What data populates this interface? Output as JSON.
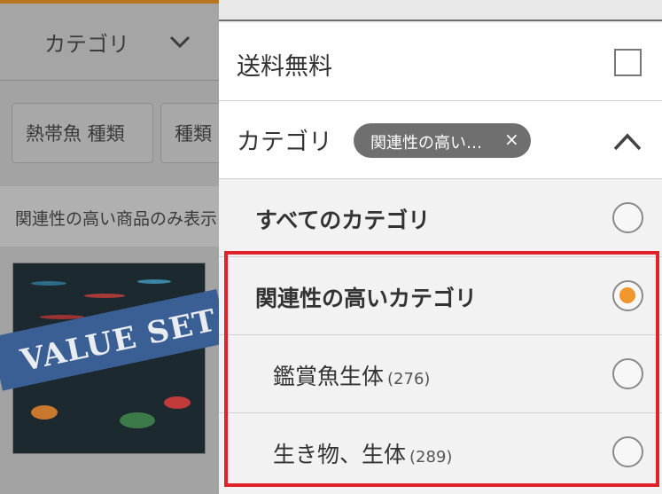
{
  "background": {
    "category_label": "カテゴリ",
    "chips": [
      "熱帯魚 種類",
      "種類"
    ],
    "notice": "関連性の高い商品のみ表示",
    "product_banner": "VALUE SET"
  },
  "drawer": {
    "shipping": {
      "label": "送料無料",
      "checked": false
    },
    "category": {
      "label": "カテゴリ",
      "chip_text": "関連性の高い…",
      "chip_close": "×",
      "expanded": true
    },
    "options": [
      {
        "label": "すべてのカテゴリ",
        "count": "",
        "selected": false
      },
      {
        "label": "関連性の高いカテゴリ",
        "count": "",
        "selected": true
      },
      {
        "label": "鑑賞魚生体",
        "count": "(276)",
        "selected": false
      },
      {
        "label": "生き物、生体",
        "count": "(289)",
        "selected": false
      }
    ]
  },
  "colors": {
    "accent": "#f0962c",
    "highlight": "#e0232b",
    "chip_bg": "#6f6f6f"
  }
}
